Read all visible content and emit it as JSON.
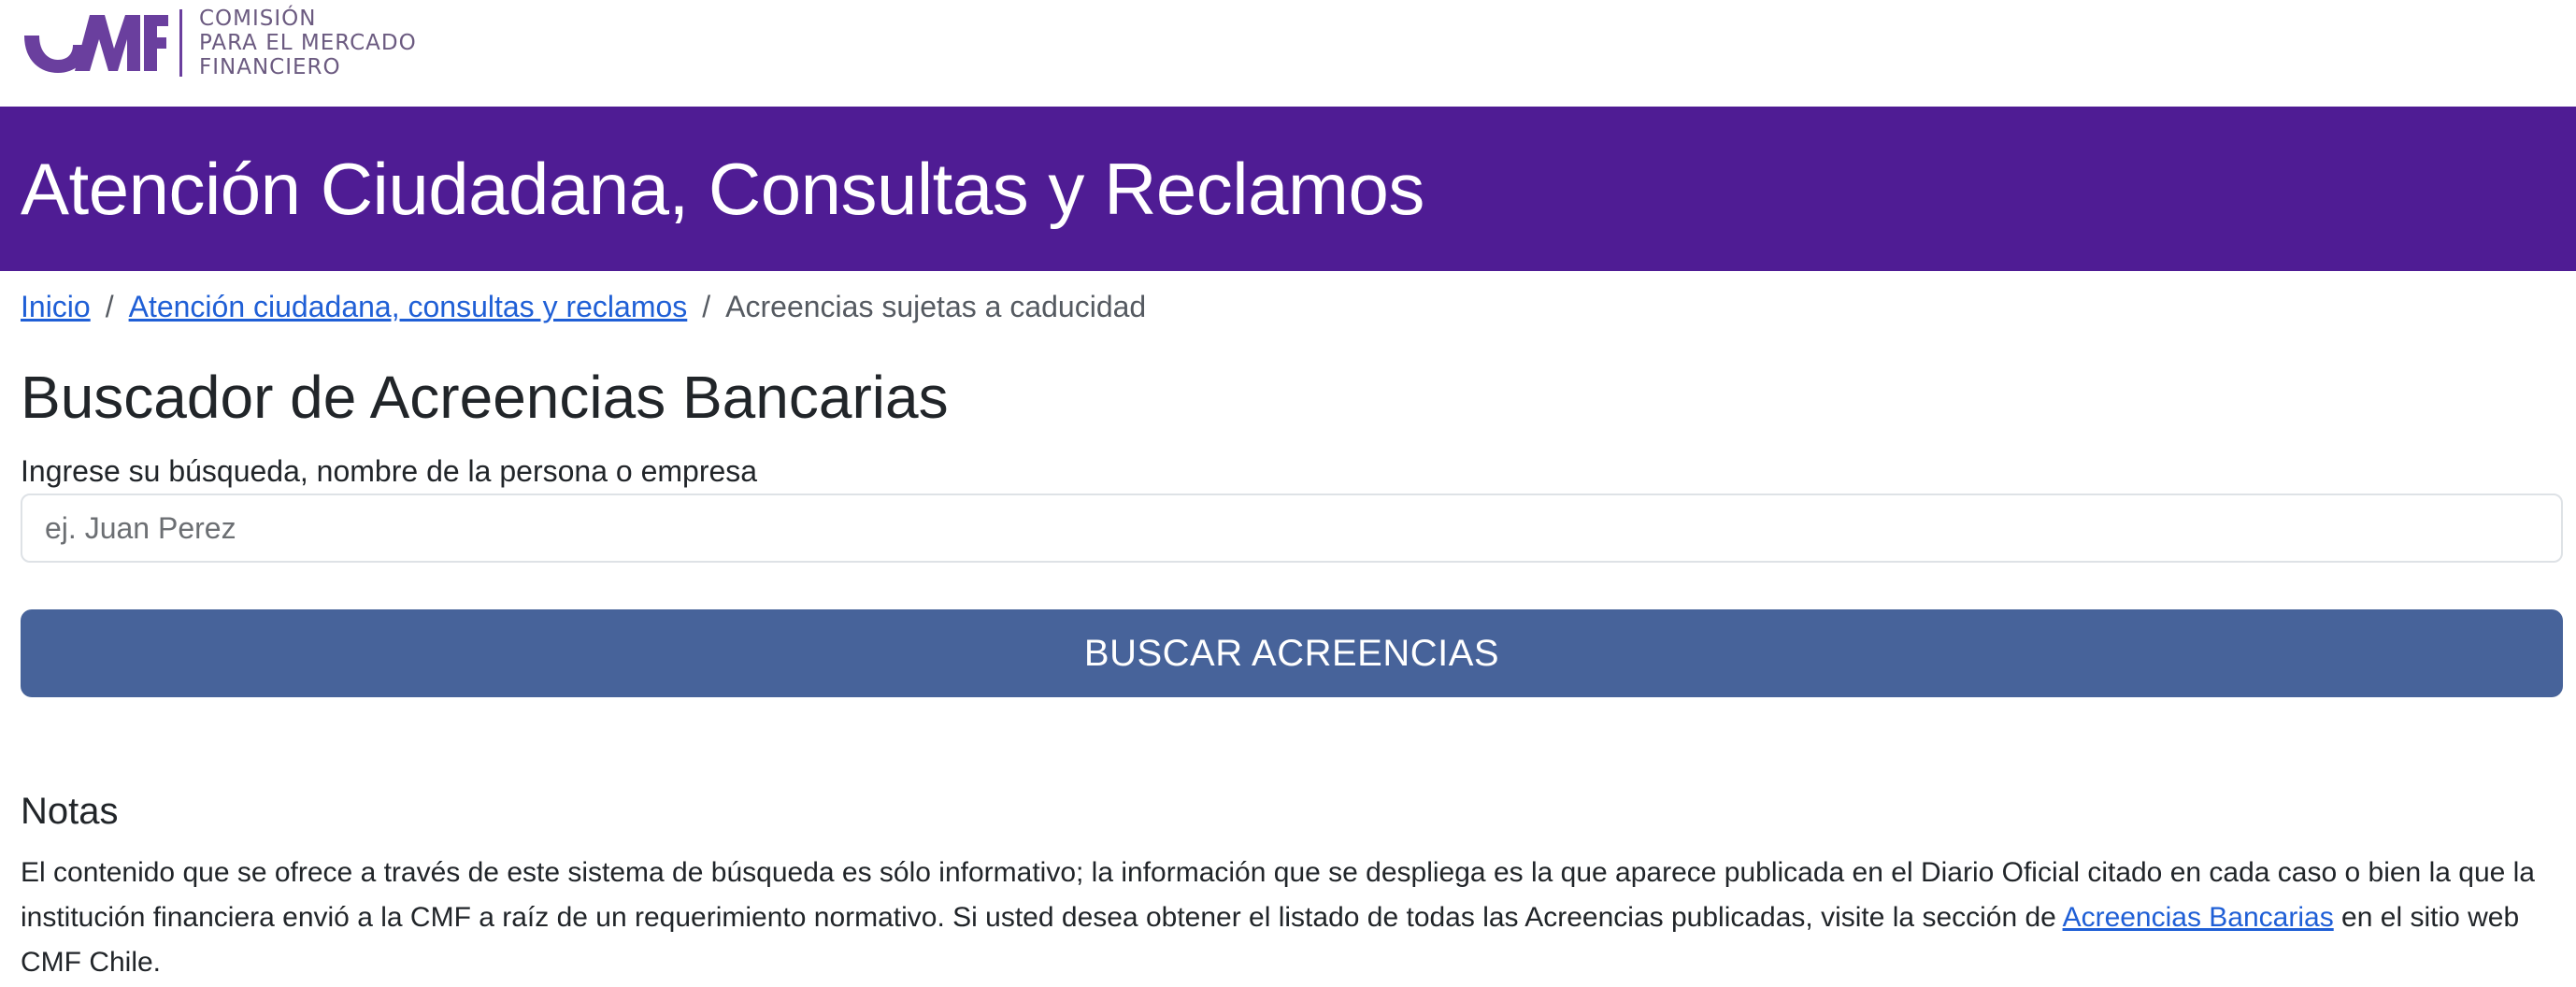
{
  "logo": {
    "lines": [
      "COMISIÓN",
      "PARA EL MERCADO",
      "FINANCIERO"
    ],
    "colors": {
      "primary": "#6a3f9e",
      "text": "#6b5a80"
    }
  },
  "banner": {
    "title": "Atención Ciudadana, Consultas y Reclamos",
    "background": "#4f1c94"
  },
  "breadcrumb": {
    "items": [
      {
        "label": "Inicio"
      },
      {
        "label": "Atención ciudadana, consultas y reclamos"
      },
      {
        "label": "Acreencias sujetas a caducidad"
      }
    ],
    "separator": "/"
  },
  "search": {
    "title": "Buscador de Acreencias Bancarias",
    "label": "Ingrese su búsqueda, nombre de la persona o empresa",
    "placeholder": "ej. Juan Perez",
    "value": "",
    "button_label": "BUSCAR ACREENCIAS",
    "button_color": "#47639a"
  },
  "notes": {
    "title": "Notas",
    "text_before_link": "El contenido que se ofrece a través de este sistema de búsqueda es sólo informativo; la información que se despliega es la que aparece publicada en el Diario Oficial citado en cada caso o bien la que la institución financiera envió a la CMF a raíz de un requerimiento normativo. Si usted desea obtener el listado de todas las Acreencias publicadas, visite la sección de ",
    "link_label": "Acreencias Bancarias",
    "text_after_link": " en el sitio web CMF Chile."
  }
}
